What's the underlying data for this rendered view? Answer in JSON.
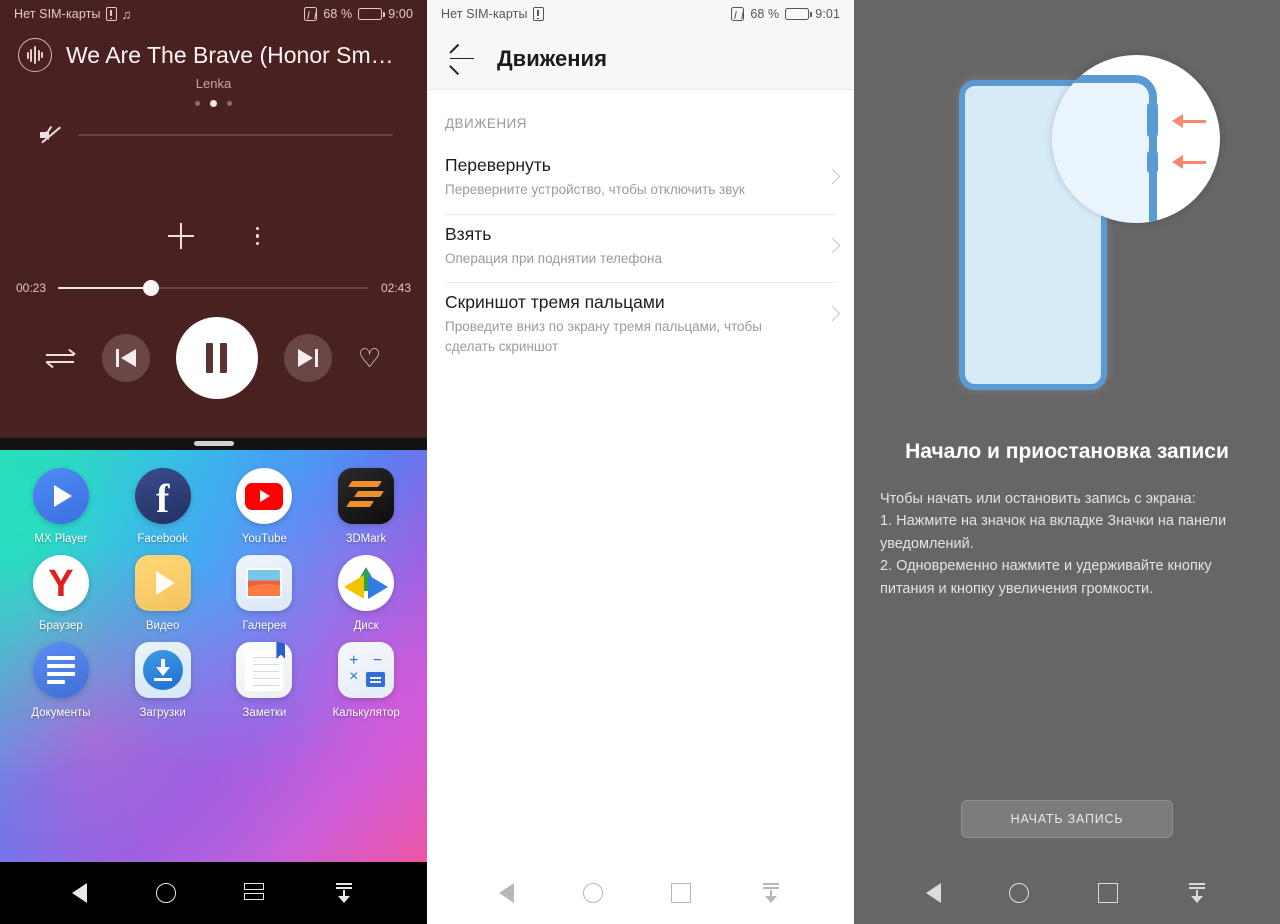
{
  "panels": {
    "player": {
      "status": {
        "sim": "Нет SIM-карты",
        "battery_pct": "68 %",
        "time": "9:00"
      },
      "track": {
        "title": "We Are The Brave (Honor Sm…",
        "artist": "Lenka"
      },
      "seek": {
        "current": "00:23",
        "total": "02:43",
        "progress_pct": 30
      },
      "icons": {
        "wave": "waveform-icon",
        "mute": "mute-icon",
        "plus": "add-icon",
        "more": "more-vertical-icon",
        "shuffle": "shuffle-icon",
        "prev": "previous-track-icon",
        "play": "pause-icon",
        "next": "next-track-icon",
        "favorite": "heart-icon"
      }
    },
    "drawer": {
      "apps": [
        {
          "label": "MX Player"
        },
        {
          "label": "Facebook"
        },
        {
          "label": "YouTube"
        },
        {
          "label": "3DMark"
        },
        {
          "label": "Браузер"
        },
        {
          "label": "Видео"
        },
        {
          "label": "Галерея"
        },
        {
          "label": "Диск"
        },
        {
          "label": "Документы"
        },
        {
          "label": "Загрузки"
        },
        {
          "label": "Заметки"
        },
        {
          "label": "Калькулятор"
        }
      ]
    },
    "settings": {
      "status": {
        "sim": "Нет SIM-карты",
        "battery_pct": "68 %",
        "time": "9:01"
      },
      "title": "Движения",
      "section_header": "ДВИЖЕНИЯ",
      "rows": [
        {
          "title": "Перевернуть",
          "subtitle": "Переверните устройство, чтобы отключить звук"
        },
        {
          "title": "Взять",
          "subtitle": "Операция при поднятии телефона"
        },
        {
          "title": "Скриншот тремя пальцами",
          "subtitle": "Проведите вниз по экрану тремя пальцами, чтобы сделать скриншот"
        }
      ]
    },
    "record": {
      "title": "Начало и приостановка записи",
      "body_lines": [
        "Чтобы начать или остановить запись с экрана:",
        "1. Нажмите на значок на вкладке Значки на панели уведомлений.",
        "2. Одновременно нажмите и удерживайте кнопку питания и кнопку увеличения громкости."
      ],
      "button_label": "НАЧАТЬ ЗАПИСЬ"
    }
  },
  "navbar": {
    "back": "back-nav-icon",
    "home": "home-nav-icon",
    "recents": "recents-nav-icon",
    "hide": "hide-navbar-icon"
  },
  "colors": {
    "player_bg": "#4a2121",
    "settings_bg": "#ffffff",
    "record_bg": "#666666",
    "accent_blue": "#5b9bd5",
    "accent_red_arrow": "#f4896f"
  }
}
